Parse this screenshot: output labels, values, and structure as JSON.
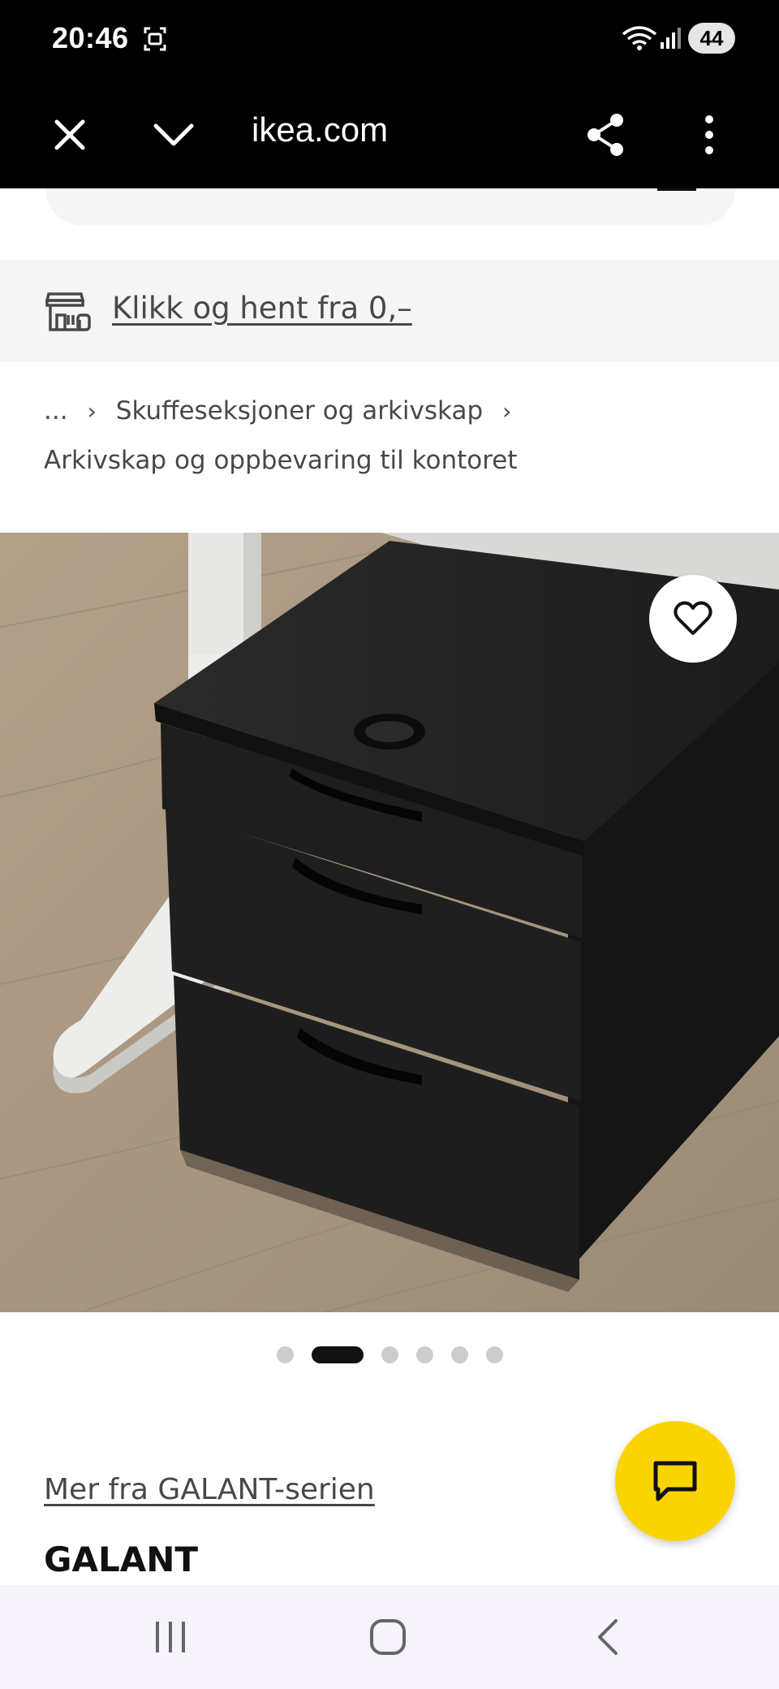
{
  "status_bar": {
    "time": "20:46",
    "battery": "44",
    "icons": [
      "screen-record-icon",
      "wifi-icon",
      "signal-icon",
      "battery-icon"
    ]
  },
  "browser": {
    "url": "ikea.com",
    "icons": [
      "close-icon",
      "chevron-down-icon",
      "share-icon",
      "more-vertical-icon"
    ]
  },
  "pickup_banner": {
    "icon": "store-icon",
    "link_text": "Klikk og hent fra 0,–"
  },
  "breadcrumb": {
    "ellipsis": "...",
    "separator": "›",
    "level1": "Skuffeseksjoner og arkivskap",
    "current": "Arkivskap og oppbevaring til kontoret"
  },
  "product": {
    "image_subject": "black drawer unit on castors beside white desk leg",
    "favourite_icon": "heart-icon",
    "carousel": {
      "total": 6,
      "active_index": 1
    },
    "series_link": "Mer fra GALANT-serien",
    "name": "GALANT"
  },
  "chat": {
    "icon": "chat-icon"
  },
  "colors": {
    "brand_yellow": "#fad400",
    "toolbar_bg": "#000000",
    "banner_bg": "#f5f5f5",
    "nav_bg": "#f6f3fb",
    "text_secondary": "#484848"
  },
  "nav_bar": {
    "icons": [
      "recents-icon",
      "home-icon",
      "back-icon"
    ]
  }
}
